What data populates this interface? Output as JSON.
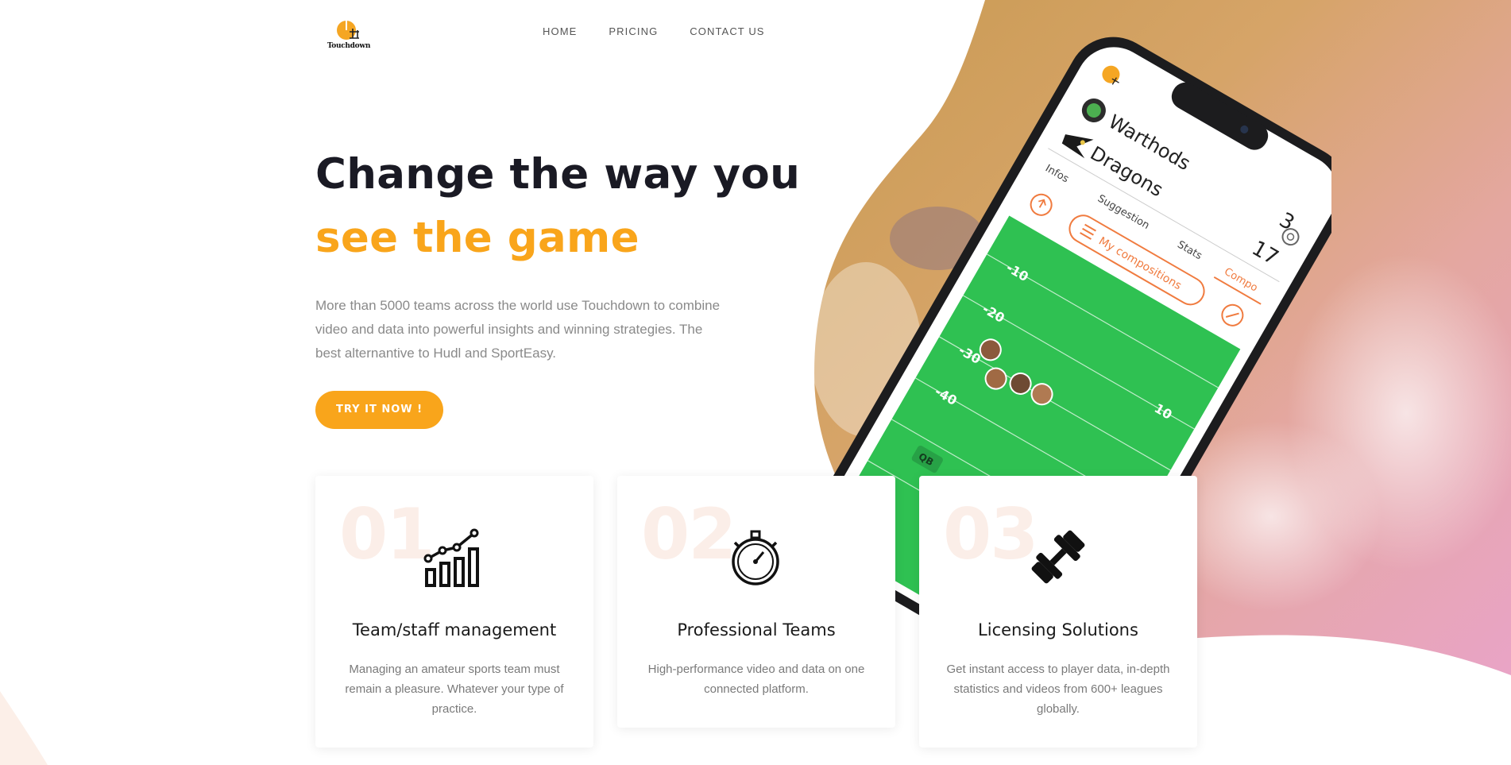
{
  "brand": {
    "logo_text": "Touchdown"
  },
  "nav": {
    "items": [
      {
        "label": "HOME"
      },
      {
        "label": "PRICING"
      },
      {
        "label": "CONTACT US"
      }
    ]
  },
  "hero": {
    "title_line1": "Change the way you",
    "title_line2": "see the game",
    "description": "More than 5000 teams across the world use Touchdown to combine video and data into powerful insights and winning strategies. The best alternantive to Hudl and SportEasy.",
    "cta_label": "TRY IT NOW !"
  },
  "phone_screen": {
    "team1": "Warthods",
    "team2": "Dragons",
    "score1": "3",
    "score2": "17",
    "tabs": [
      "Infos",
      "Suggestion",
      "Stats",
      "Compo"
    ],
    "compositions_button": "My compositions",
    "field_labels": [
      "-10",
      "-20",
      "10",
      "-30",
      "-40"
    ],
    "position_badge": "QB"
  },
  "features": [
    {
      "number": "01",
      "icon": "chart-growth-icon",
      "title": "Team/staff management",
      "desc": "Managing an amateur sports team must remain a pleasure. Whatever your type of practice."
    },
    {
      "number": "02",
      "icon": "stopwatch-icon",
      "title": "Professional Teams",
      "desc": "High-performance video and data on one connected platform."
    },
    {
      "number": "03",
      "icon": "dumbbell-icon",
      "title": "Licensing Solutions",
      "desc": "Get instant access to player data, in-depth statistics and videos from 600+ leagues globally."
    }
  ],
  "colors": {
    "accent": "#f9a51b",
    "heading": "#1a1a24",
    "number_tint": "#fbeee8",
    "field_green": "#2fc152"
  }
}
